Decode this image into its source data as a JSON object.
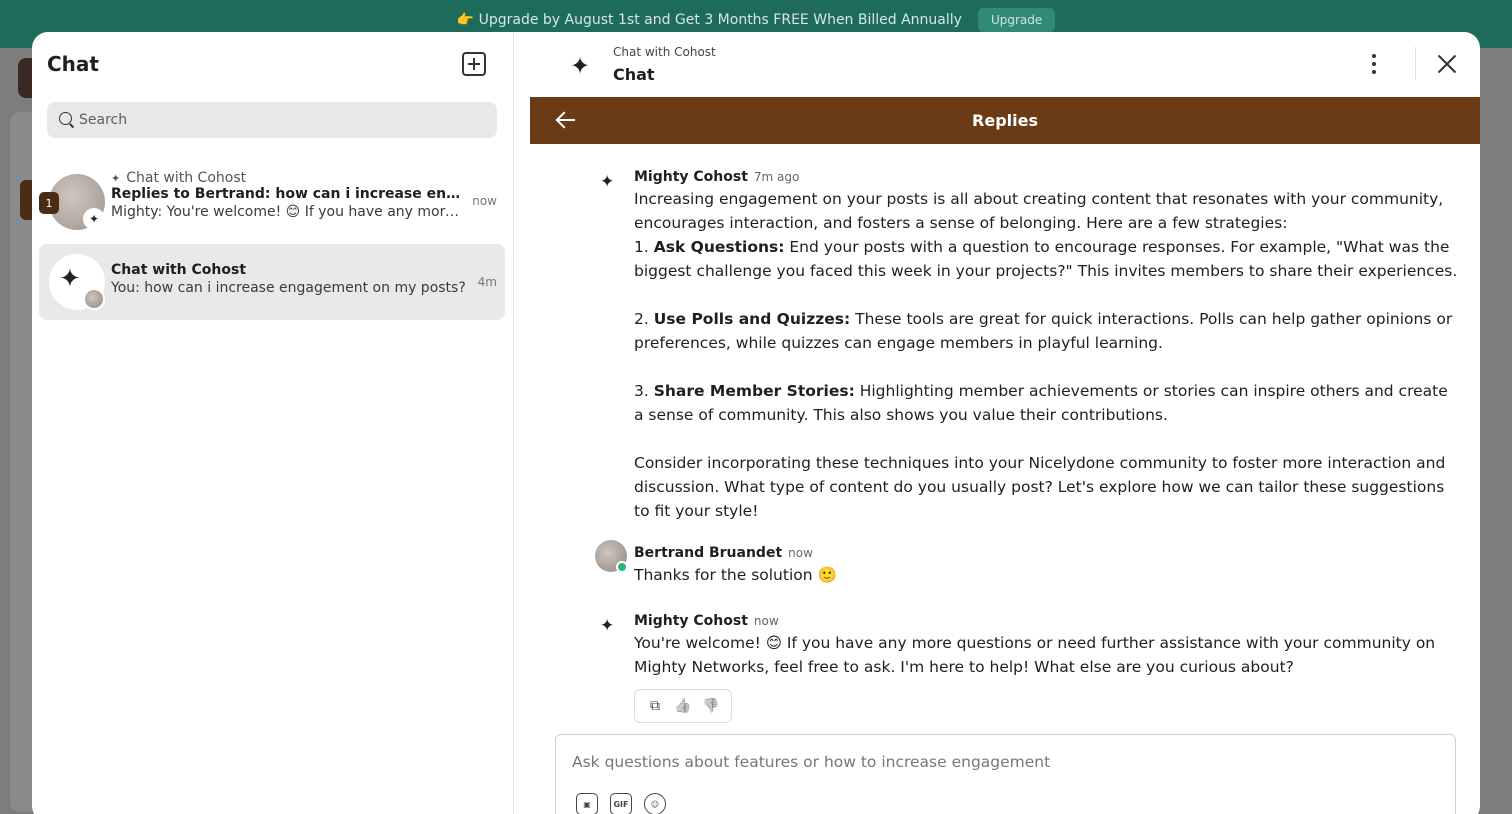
{
  "banner": {
    "text": "👉 Upgrade by August 1st and Get 3 Months FREE When Billed Annually",
    "button": "Upgrade"
  },
  "sidebar": {
    "title": "Chat",
    "search_placeholder": "Search",
    "conversations": [
      {
        "subtitle": "Chat with Cohost",
        "title": "Replies to Bertrand: how can i increase engagement on my posts?",
        "preview": "Mighty: You're welcome! 😊 If you have any more questions or need further assistance",
        "time": "now",
        "unread": "1"
      },
      {
        "title": "Chat with Cohost",
        "preview": "You: how can i increase engagement on my posts?",
        "time": "4m"
      }
    ]
  },
  "header": {
    "subtitle": "Chat with Cohost",
    "title": "Chat"
  },
  "thread": {
    "title": "Replies",
    "messages": [
      {
        "author": "Mighty Cohost",
        "time": "7m ago",
        "intro": "Increasing engagement on your posts is all about creating content that resonates with your community, encourages interaction, and fosters a sense of belonging. Here are a few strategies:",
        "point1_prefix": "1. ",
        "point1_label": "Ask Questions:",
        "point1_text": " End your posts with a question to encourage responses. For example, \"What was the biggest challenge you faced this week in your projects?\" This invites members to share their experiences.",
        "point2_prefix": "2. ",
        "point2_label": "Use Polls and Quizzes:",
        "point2_text": " These tools are great for quick interactions. Polls can help gather opinions or preferences, while quizzes can engage members in playful learning.",
        "point3_prefix": "3. ",
        "point3_label": "Share Member Stories:",
        "point3_text": " Highlighting member achievements or stories can inspire others and create a sense of community. This also shows you value their contributions.",
        "outro": "Consider incorporating these techniques into your Nicelydone community to foster more interaction and discussion. What type of content do you usually post? Let's explore how we can tailor these suggestions to fit your style!"
      },
      {
        "author": "Bertrand Bruandet",
        "time": "now",
        "body": "Thanks for the solution 🙂"
      },
      {
        "author": "Mighty Cohost",
        "time": "now",
        "body": "You're welcome! 😊 If you have any more questions or need further assistance with your community on Mighty Networks, feel free to ask. I'm here to help! What else are you curious about?"
      }
    ]
  },
  "composer": {
    "placeholder": "Ask questions about features or how to increase engagement",
    "gif_label": "GIF"
  },
  "icons": {
    "spark": "✦",
    "copy": "⧉",
    "like": "👍",
    "dislike": "👎"
  }
}
